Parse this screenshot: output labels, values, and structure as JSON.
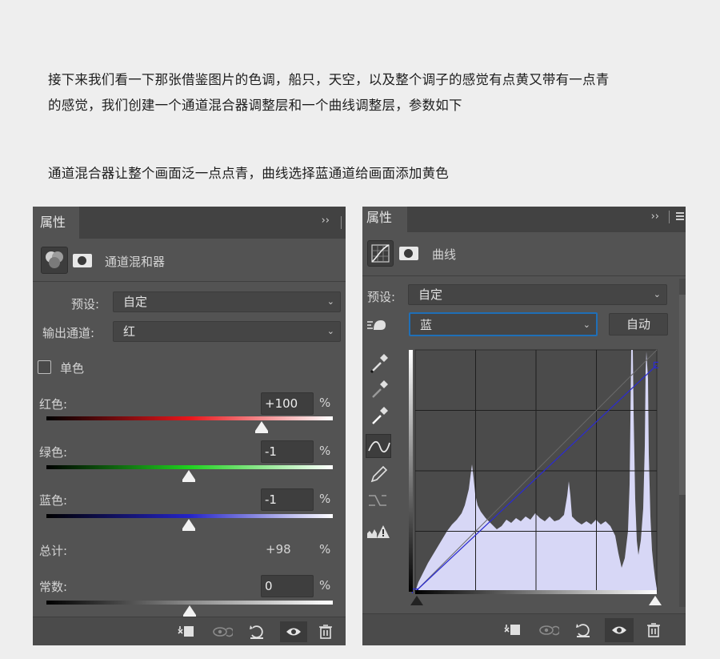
{
  "article": {
    "line1": "接下来我们看一下那张借鉴图片的色调，船只，天空，以及整个调子的感觉有点黄又带有一点青",
    "line2": "的感觉，我们创建一个通道混合器调整层和一个曲线调整层，参数如下",
    "line3": "通道混合器让整个画面泛一点点青，曲线选择蓝通道给画面添加黄色"
  },
  "mixer": {
    "tab_label": "属性",
    "collapse_glyph": "››",
    "title": "通道混和器",
    "preset_label": "预设:",
    "preset_value": "自定",
    "output_label": "输出通道:",
    "output_value": "红",
    "mono_label": "单色",
    "mono_checked": false,
    "red_label": "红色:",
    "red_value": "+100",
    "green_label": "绿色:",
    "green_value": "-1",
    "blue_label": "蓝色:",
    "blue_value": "-1",
    "total_label": "总计:",
    "total_value": "+98",
    "constant_label": "常数:",
    "constant_value": "0",
    "percent": "%",
    "slider_levels": {
      "red": 100,
      "green": -1,
      "blue": -1,
      "constant": 0
    },
    "slider_range": [
      -200,
      200
    ],
    "colors": {
      "red": "#e8161b",
      "green": "#1fd11f",
      "blue": "#2424c8",
      "panel": "#535353"
    }
  },
  "curves": {
    "tab_label": "属性",
    "collapse_glyph": "››",
    "title": "曲线",
    "preset_label": "预设:",
    "preset_value": "自定",
    "channel_value": "蓝",
    "auto_label": "自动",
    "tools": [
      "on-image-adjust-icon",
      "black-point-eyedropper-icon",
      "gray-point-eyedropper-icon",
      "white-point-eyedropper-icon",
      "curve-points-icon",
      "pencil-icon",
      "smooth-icon",
      "clipping-warning-icon"
    ],
    "curve_points": [
      [
        0,
        0
      ],
      [
        255,
        239
      ]
    ],
    "histogram_color": "#d7d7f6",
    "curve_color": "#2b2bd0"
  },
  "footer_icons": [
    "clip-to-layer-icon",
    "view-previous-icon",
    "reset-icon",
    "visibility-eye-icon",
    "trash-icon"
  ]
}
